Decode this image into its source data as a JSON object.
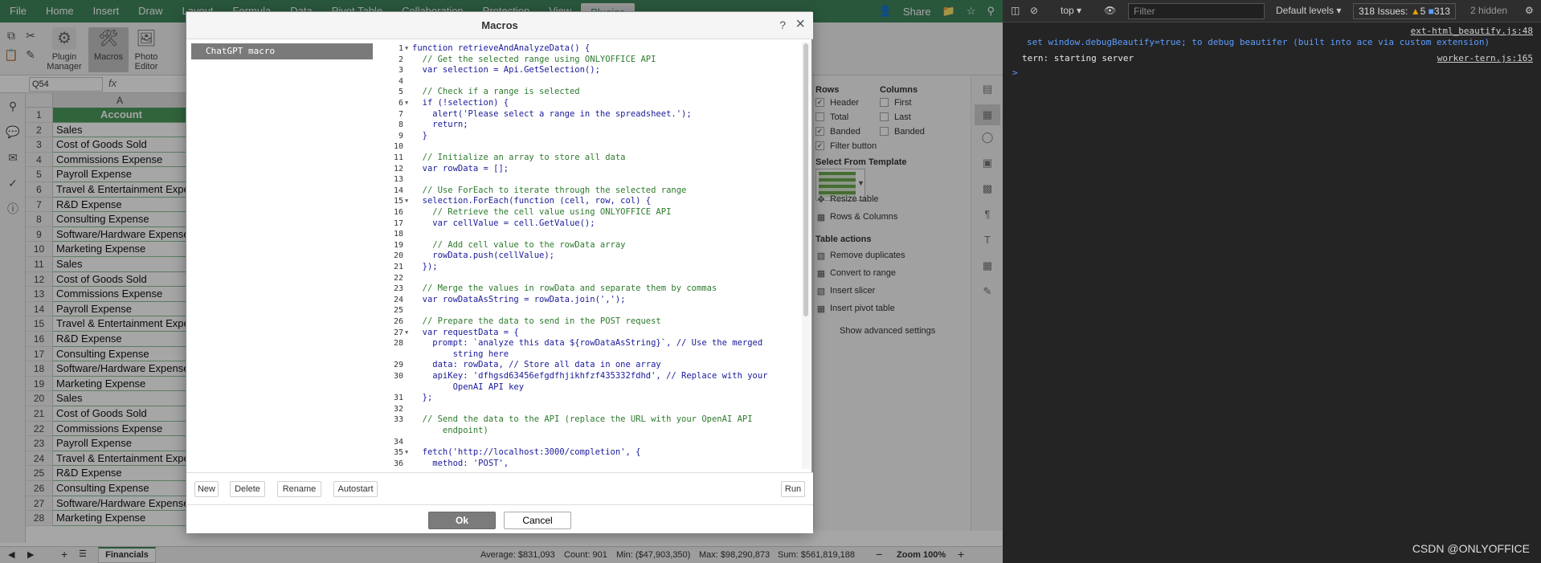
{
  "menubar": {
    "items": [
      "File",
      "Home",
      "Insert",
      "Draw",
      "Layout",
      "Formula",
      "Data",
      "Pivot Table",
      "Collaboration",
      "Protection",
      "View",
      "Plugins"
    ],
    "active": "Plugins",
    "share_label": "Share"
  },
  "ribbon": {
    "plugin_manager": "Plugin Manager",
    "macros": "Macros",
    "photo_editor": "Photo Editor"
  },
  "formula": {
    "namebox": "Q54",
    "fx": "fx"
  },
  "grid": {
    "column": "A",
    "rows": [
      {
        "n": "1",
        "v": "Account"
      },
      {
        "n": "2",
        "v": "Sales"
      },
      {
        "n": "3",
        "v": "Cost of Goods Sold"
      },
      {
        "n": "4",
        "v": "Commissions Expense"
      },
      {
        "n": "5",
        "v": "Payroll Expense"
      },
      {
        "n": "6",
        "v": "Travel & Entertainment Expense"
      },
      {
        "n": "7",
        "v": "R&D Expense"
      },
      {
        "n": "8",
        "v": "Consulting Expense"
      },
      {
        "n": "9",
        "v": "Software/Hardware Expense"
      },
      {
        "n": "10",
        "v": "Marketing Expense"
      },
      {
        "n": "11",
        "v": "Sales"
      },
      {
        "n": "12",
        "v": "Cost of Goods Sold"
      },
      {
        "n": "13",
        "v": "Commissions Expense"
      },
      {
        "n": "14",
        "v": "Payroll Expense"
      },
      {
        "n": "15",
        "v": "Travel & Entertainment Expense"
      },
      {
        "n": "16",
        "v": "R&D Expense"
      },
      {
        "n": "17",
        "v": "Consulting Expense"
      },
      {
        "n": "18",
        "v": "Software/Hardware Expense"
      },
      {
        "n": "19",
        "v": "Marketing Expense"
      },
      {
        "n": "20",
        "v": "Sales"
      },
      {
        "n": "21",
        "v": "Cost of Goods Sold"
      },
      {
        "n": "22",
        "v": "Commissions Expense"
      },
      {
        "n": "23",
        "v": "Payroll Expense"
      },
      {
        "n": "24",
        "v": "Travel & Entertainment Expense"
      },
      {
        "n": "25",
        "v": "R&D Expense"
      },
      {
        "n": "26",
        "v": "Consulting Expense"
      },
      {
        "n": "27",
        "v": "Software/Hardware Expense"
      },
      {
        "n": "28",
        "v": "Marketing Expense"
      }
    ]
  },
  "table_settings": {
    "rows_title": "Rows",
    "columns_title": "Columns",
    "header": "Header",
    "total": "Total",
    "banded_rows": "Banded",
    "filter_button": "Filter button",
    "first": "First",
    "last": "Last",
    "banded_cols": "Banded",
    "select_template": "Select From Template",
    "resize_table": "Resize table",
    "rows_columns": "Rows & Columns",
    "table_actions": "Table actions",
    "remove_duplicates": "Remove duplicates",
    "convert_to_range": "Convert to range",
    "insert_slicer": "Insert slicer",
    "insert_pivot": "Insert pivot table",
    "show_advanced": "Show advanced settings"
  },
  "status": {
    "sheet": "Financials",
    "average": "Average: $831,093",
    "count": "Count: 901",
    "min": "Min: ($47,903,350)",
    "max": "Max: $98,290,873",
    "sum": "Sum: $561,819,188",
    "zoom": "Zoom 100%"
  },
  "dialog": {
    "title": "Macros",
    "help": "?",
    "close": "×",
    "macro_name": "ChatGPT macro",
    "new": "New",
    "delete": "Delete",
    "rename": "Rename",
    "autostart": "Autostart",
    "run": "Run",
    "ok": "Ok",
    "cancel": "Cancel",
    "code_lines": [
      {
        "n": "1",
        "t": "function retrieveAndAnalyzeData() {",
        "c": false,
        "fold": true
      },
      {
        "n": "2",
        "t": "  // Get the selected range using ONLYOFFICE API",
        "c": true
      },
      {
        "n": "3",
        "t": "  var selection = Api.GetSelection();",
        "c": false
      },
      {
        "n": "4",
        "t": "",
        "c": false
      },
      {
        "n": "5",
        "t": "  // Check if a range is selected",
        "c": true
      },
      {
        "n": "6",
        "t": "  if (!selection) {",
        "c": false,
        "fold": true
      },
      {
        "n": "7",
        "t": "    alert('Please select a range in the spreadsheet.');",
        "c": false
      },
      {
        "n": "8",
        "t": "    return;",
        "c": false
      },
      {
        "n": "9",
        "t": "  }",
        "c": false
      },
      {
        "n": "10",
        "t": "",
        "c": false
      },
      {
        "n": "11",
        "t": "  // Initialize an array to store all data",
        "c": true
      },
      {
        "n": "12",
        "t": "  var rowData = [];",
        "c": false
      },
      {
        "n": "13",
        "t": "",
        "c": false
      },
      {
        "n": "14",
        "t": "  // Use ForEach to iterate through the selected range",
        "c": true
      },
      {
        "n": "15",
        "t": "  selection.ForEach(function (cell, row, col) {",
        "c": false,
        "fold": true
      },
      {
        "n": "16",
        "t": "    // Retrieve the cell value using ONLYOFFICE API",
        "c": true
      },
      {
        "n": "17",
        "t": "    var cellValue = cell.GetValue();",
        "c": false
      },
      {
        "n": "18",
        "t": "",
        "c": false
      },
      {
        "n": "19",
        "t": "    // Add cell value to the rowData array",
        "c": true
      },
      {
        "n": "20",
        "t": "    rowData.push(cellValue);",
        "c": false
      },
      {
        "n": "21",
        "t": "  });",
        "c": false
      },
      {
        "n": "22",
        "t": "",
        "c": false
      },
      {
        "n": "23",
        "t": "  // Merge the values in rowData and separate them by commas",
        "c": true
      },
      {
        "n": "24",
        "t": "  var rowDataAsString = rowData.join(',');",
        "c": false
      },
      {
        "n": "25",
        "t": "",
        "c": false
      },
      {
        "n": "26",
        "t": "  // Prepare the data to send in the POST request",
        "c": true
      },
      {
        "n": "27",
        "t": "  var requestData = {",
        "c": false,
        "fold": true
      },
      {
        "n": "28",
        "t": "    prompt: `analyze this data ${rowDataAsString}`, // Use the merged",
        "c": false
      },
      {
        "n": "",
        "t": "        string here",
        "c": false
      },
      {
        "n": "29",
        "t": "    data: rowData, // Store all data in one array",
        "c": false
      },
      {
        "n": "30",
        "t": "    apiKey: 'dfhgsd63456efgdfhjikhfzf435332fdhd', // Replace with your",
        "c": false
      },
      {
        "n": "",
        "t": "        OpenAI API key",
        "c": false
      },
      {
        "n": "31",
        "t": "  };",
        "c": false
      },
      {
        "n": "32",
        "t": "",
        "c": false
      },
      {
        "n": "33",
        "t": "  // Send the data to the API (replace the URL with your OpenAI API",
        "c": true
      },
      {
        "n": "",
        "t": "      endpoint)",
        "c": true
      },
      {
        "n": "34",
        "t": "",
        "c": false
      },
      {
        "n": "35",
        "t": "  fetch('http://localhost:3000/completion', {",
        "c": false,
        "fold": true
      },
      {
        "n": "36",
        "t": "    method: 'POST',",
        "c": false
      }
    ]
  },
  "devtools": {
    "context": "top",
    "filter_placeholder": "Filter",
    "levels": "Default levels",
    "issues_label": "318 Issues:",
    "issues_warn": "5",
    "issues_info": "313",
    "hidden": "2 hidden",
    "log1_source": "ext-html_beautify.js:48",
    "log1_text": "set window.debugBeautify=true; to debug beautifer (built into ace via custom extension)",
    "log2_text": "tern: starting server",
    "log2_source": "worker-tern.js:165",
    "prompt": ">",
    "watermark": "CSDN @ONLYOFFICE"
  }
}
